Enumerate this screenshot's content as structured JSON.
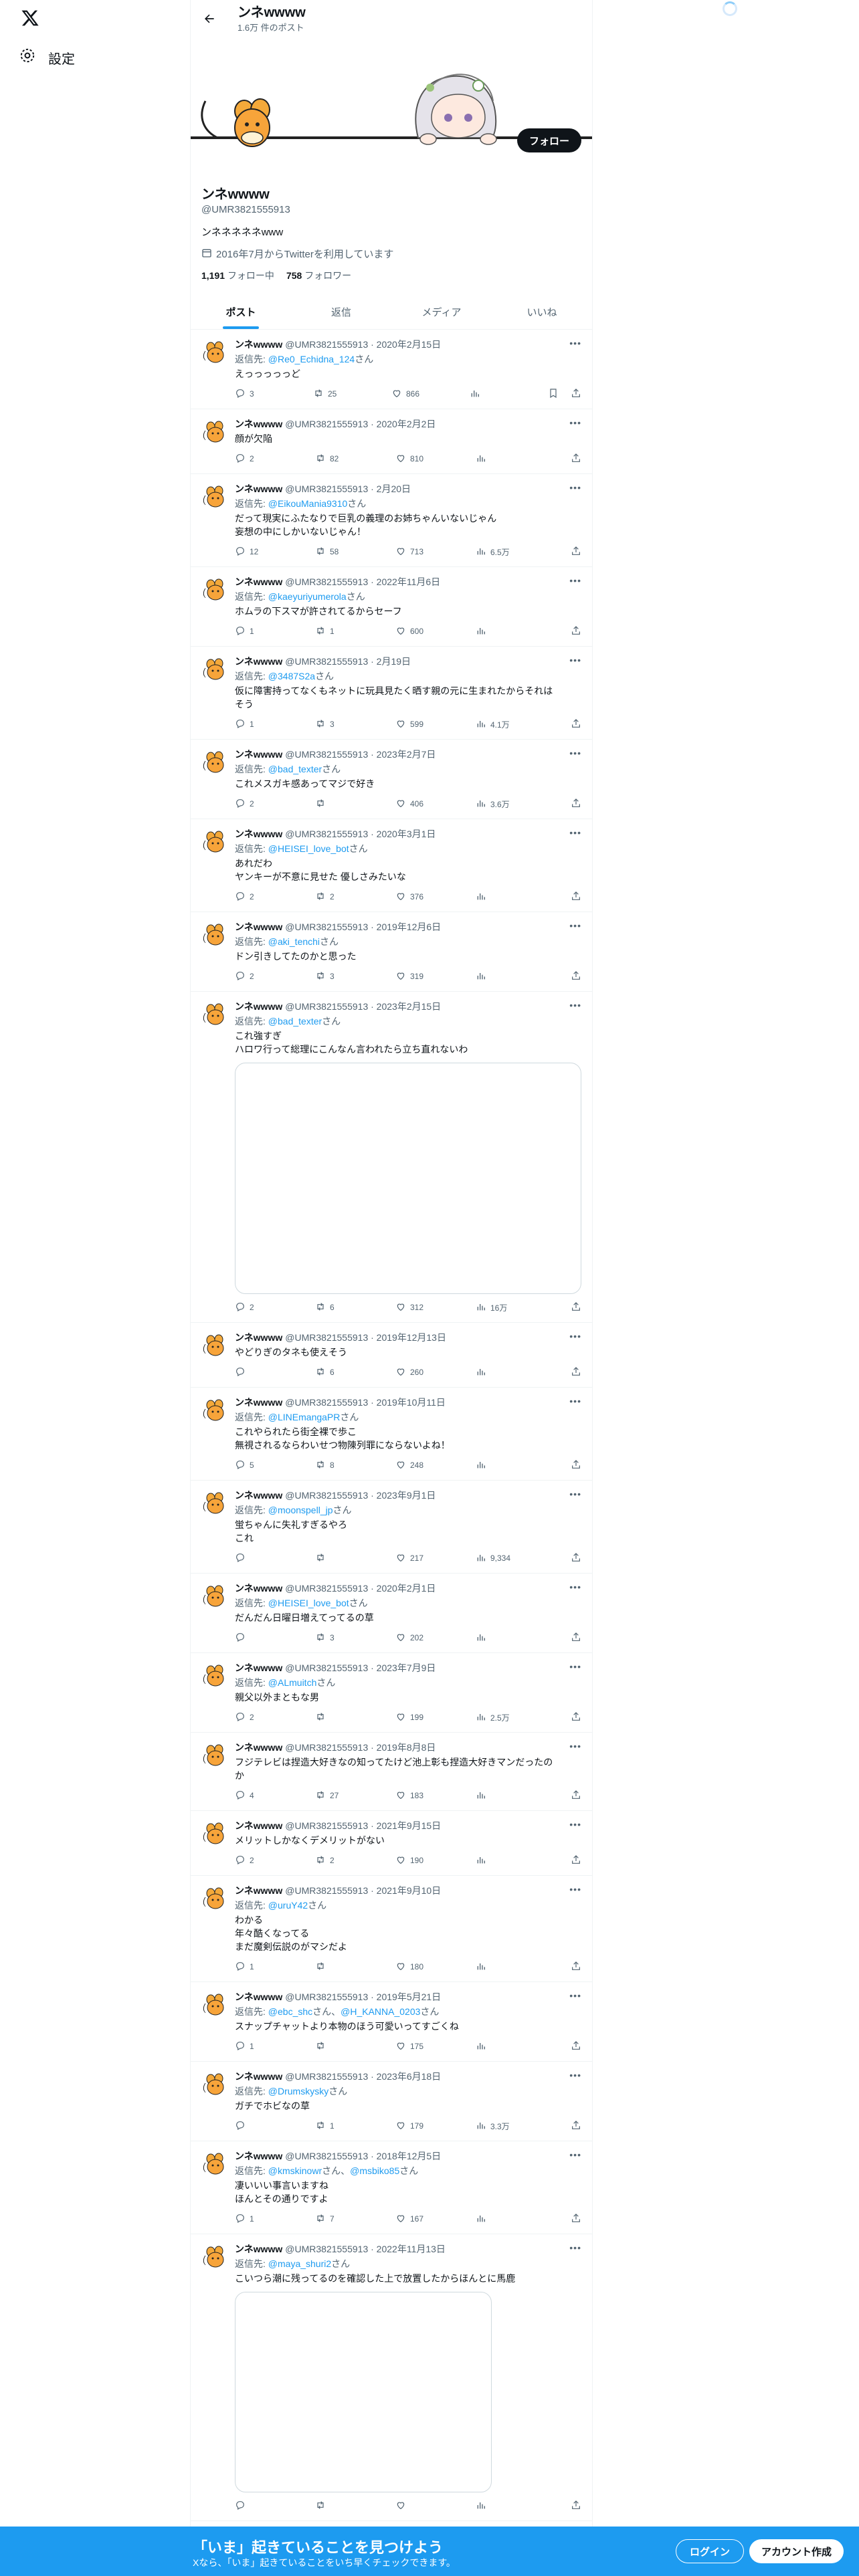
{
  "sidebar": {
    "settings_label": "設定",
    "logo_icon": "x-logo-icon",
    "settings_icon": "gear-icon"
  },
  "header": {
    "title": "ンネwwww",
    "subtitle": "1.6万 件のポスト"
  },
  "profile": {
    "follow_label": "フォロー",
    "name": "ンネwwww",
    "handle": "@UMR3821555913",
    "bio": "ンネネネネネwww",
    "joined": "2016年7月からTwitterを利用しています",
    "following_count": "1,191",
    "following_label": "フォロー中",
    "followers_count": "758",
    "followers_label": "フォロワー"
  },
  "tabs": [
    {
      "label": "ポスト",
      "active": true
    },
    {
      "label": "返信",
      "active": false
    },
    {
      "label": "メディア",
      "active": false
    },
    {
      "label": "いいね",
      "active": false
    }
  ],
  "tweets": [
    {
      "name": "ンネwwww",
      "meta": "@UMR3821555913 · 2020年2月15日",
      "reply_prefix": "返信先: ",
      "reply_to": "@Re0_Echidna_124",
      "reply_suffix": "さん",
      "lines": [
        "えっっっっっど"
      ],
      "replies": "3",
      "retweets": "25",
      "likes": "866",
      "views": "",
      "bookmark": true
    },
    {
      "name": "ンネwwww",
      "meta": "@UMR3821555913 · 2020年2月2日",
      "lines": [
        "顔が欠陥"
      ],
      "replies": "2",
      "retweets": "82",
      "likes": "810",
      "views": ""
    },
    {
      "name": "ンネwwww",
      "meta": "@UMR3821555913 · 2月20日",
      "reply_prefix": "返信先: ",
      "reply_to": "@EikouMania9310",
      "reply_suffix": "さん",
      "lines": [
        "だって現実にふたなりで巨乳の義理のお姉ちゃんいないじゃん",
        "妄想の中にしかいないじゃん！"
      ],
      "replies": "12",
      "retweets": "58",
      "likes": "713",
      "views": "6.5万"
    },
    {
      "name": "ンネwwww",
      "meta": "@UMR3821555913 · 2022年11月6日",
      "reply_prefix": "返信先: ",
      "reply_to": "@kaeyuriyumerola",
      "reply_suffix": "さん",
      "lines": [
        "ホムラの下スマが許されてるからセーフ"
      ],
      "replies": "1",
      "retweets": "1",
      "likes": "600",
      "views": ""
    },
    {
      "name": "ンネwwww",
      "meta": "@UMR3821555913 · 2月19日",
      "reply_prefix": "返信先: ",
      "reply_to": "@3487S2a",
      "reply_suffix": "さん",
      "lines": [
        "仮に障害持ってなくもネットに玩具見たく晒す親の元に生まれたからそれは",
        "そう"
      ],
      "replies": "1",
      "retweets": "3",
      "likes": "599",
      "views": "4.1万"
    },
    {
      "name": "ンネwwww",
      "meta": "@UMR3821555913 · 2023年2月7日",
      "reply_prefix": "返信先: ",
      "reply_to": "@bad_texter",
      "reply_suffix": "さん",
      "lines": [
        "これメスガキ感あってマジで好き"
      ],
      "replies": "2",
      "retweets": "",
      "likes": "406",
      "views": "3.6万"
    },
    {
      "name": "ンネwwww",
      "meta": "@UMR3821555913 · 2020年3月1日",
      "reply_prefix": "返信先: ",
      "reply_to": "@HEISEI_love_bot",
      "reply_suffix": "さん",
      "lines": [
        "あれだわ",
        "ヤンキーが不意に見せた 優しさみたいな"
      ],
      "replies": "2",
      "retweets": "2",
      "likes": "376",
      "views": ""
    },
    {
      "name": "ンネwwww",
      "meta": "@UMR3821555913 · 2019年12月6日",
      "reply_prefix": "返信先: ",
      "reply_to": "@aki_tenchi",
      "reply_suffix": "さん",
      "lines": [
        "ドン引きしてたのかと思った"
      ],
      "replies": "2",
      "retweets": "3",
      "likes": "319",
      "views": ""
    },
    {
      "name": "ンネwwww",
      "meta": "@UMR3821555913 · 2023年2月15日",
      "reply_prefix": "返信先: ",
      "reply_to": "@bad_texter",
      "reply_suffix": "さん",
      "lines": [
        "これ強すぎ",
        "ハロワ行って総理にこんなん言われたら立ち直れないわ"
      ],
      "media": "tall",
      "replies": "2",
      "retweets": "6",
      "likes": "312",
      "views": "16万"
    },
    {
      "name": "ンネwwww",
      "meta": "@UMR3821555913 · 2019年12月13日",
      "lines": [
        "やどりぎのタネも使えそう"
      ],
      "replies": "",
      "retweets": "6",
      "likes": "260",
      "views": ""
    },
    {
      "name": "ンネwwww",
      "meta": "@UMR3821555913 · 2019年10月11日",
      "reply_prefix": "返信先: ",
      "reply_to": "@LINEmangaPR",
      "reply_suffix": "さん",
      "lines": [
        "これやられたら街全裸で歩こ",
        "無視されるならわいせつ物陳列罪にならないよね！"
      ],
      "replies": "5",
      "retweets": "8",
      "likes": "248",
      "views": ""
    },
    {
      "name": "ンネwwww",
      "meta": "@UMR3821555913 · 2023年9月1日",
      "reply_prefix": "返信先: ",
      "reply_to": "@moonspell_jp",
      "reply_suffix": "さん",
      "lines": [
        "蛍ちゃんに失礼すぎるやろ",
        "これ"
      ],
      "replies": "",
      "retweets": "",
      "likes": "217",
      "views": "9,334"
    },
    {
      "name": "ンネwwww",
      "meta": "@UMR3821555913 · 2020年2月1日",
      "reply_prefix": "返信先: ",
      "reply_to": "@HEISEI_love_bot",
      "reply_suffix": "さん",
      "lines": [
        "だんだん日曜日増えてってるの草"
      ],
      "replies": "",
      "retweets": "3",
      "likes": "202",
      "views": ""
    },
    {
      "name": "ンネwwww",
      "meta": "@UMR3821555913 · 2023年7月9日",
      "reply_prefix": "返信先: ",
      "reply_to": "@ALmuitch",
      "reply_suffix": "さん",
      "lines": [
        "親父以外まともな男"
      ],
      "replies": "2",
      "retweets": "",
      "likes": "199",
      "views": "2.5万"
    },
    {
      "name": "ンネwwww",
      "meta": "@UMR3821555913 · 2019年8月8日",
      "lines": [
        "フジテレビは捏造大好きなの知ってたけど池上彰も捏造大好きマンだったの",
        "か"
      ],
      "replies": "4",
      "retweets": "27",
      "likes": "183",
      "views": ""
    },
    {
      "name": "ンネwwww",
      "meta": "@UMR3821555913 · 2021年9月15日",
      "lines": [
        "メリットしかなくデメリットがない"
      ],
      "replies": "2",
      "retweets": "2",
      "likes": "190",
      "views": ""
    },
    {
      "name": "ンネwwww",
      "meta": "@UMR3821555913 · 2021年9月10日",
      "reply_prefix": "返信先: ",
      "reply_to": "@uruY42",
      "reply_suffix": "さん",
      "lines": [
        "わかる",
        "年々酷くなってる",
        "まだ魔剣伝説のがマシだよ"
      ],
      "replies": "1",
      "retweets": "",
      "likes": "180",
      "views": ""
    },
    {
      "name": "ンネwwww",
      "meta": "@UMR3821555913 · 2019年5月21日",
      "reply_prefix": "返信先: ",
      "reply_to": "@ebc_shc",
      "reply_mid": "さん、",
      "reply_to2": "@H_KANNA_0203",
      "reply_suffix": "さん",
      "lines": [
        "スナップチャットより本物のほう可愛いってすごくね"
      ],
      "replies": "1",
      "retweets": "",
      "likes": "175",
      "views": ""
    },
    {
      "name": "ンネwwww",
      "meta": "@UMR3821555913 · 2023年6月18日",
      "reply_prefix": "返信先: ",
      "reply_to": "@Drumskysky",
      "reply_suffix": "さん",
      "lines": [
        "ガチでホビなの草"
      ],
      "replies": "",
      "retweets": "1",
      "likes": "179",
      "views": "3.3万"
    },
    {
      "name": "ンネwwww",
      "meta": "@UMR3821555913 · 2018年12月5日",
      "reply_prefix": "返信先: ",
      "reply_to": "@kmskinowr",
      "reply_mid": "さん、",
      "reply_to2": "@msbiko85",
      "reply_suffix": "さん",
      "lines": [
        "凄いいい事言いますね",
        "ほんとその通りですよ"
      ],
      "replies": "1",
      "retweets": "7",
      "likes": "167",
      "views": ""
    },
    {
      "name": "ンネwwww",
      "meta": "@UMR3821555913 · 2022年11月13日",
      "reply_prefix": "返信先: ",
      "reply_to": "@maya_shuri2",
      "reply_suffix": "さん",
      "lines": [
        "こいつら潮に残ってるのを確認した上で放置したからほんとに馬鹿"
      ],
      "media": "partial",
      "replies": "",
      "retweets": "",
      "likes": "",
      "views": ""
    }
  ],
  "bottom_bar": {
    "title": "「いま」起きていることを見つけよう",
    "subtitle": "Xなら、「いま」起きていることをいち早くチェックできます。",
    "login": "ログイン",
    "signup": "アカウント作成"
  }
}
